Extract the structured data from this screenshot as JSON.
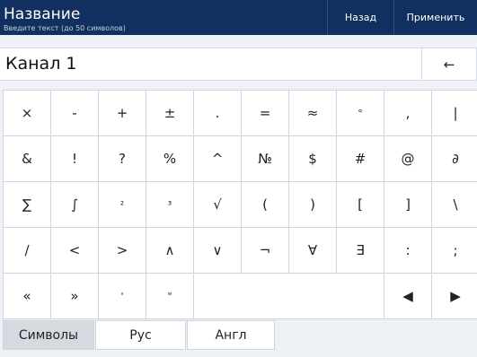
{
  "header": {
    "title": "Название",
    "subtitle": "Введите текст (до 50 символов)",
    "back_label": "Назад",
    "apply_label": "Применить"
  },
  "input": {
    "value": "Канал 1",
    "backspace_label": "←"
  },
  "keys": [
    [
      "×",
      "-",
      "+",
      "±",
      ".",
      "=",
      "≈",
      "°",
      ",",
      "|"
    ],
    [
      "&",
      "!",
      "?",
      "%",
      "^",
      "№",
      "$",
      "#",
      "@",
      "∂"
    ],
    [
      "∑",
      "∫",
      "²",
      "³",
      "√",
      "(",
      ")",
      "[",
      "]",
      "\\"
    ],
    [
      "/",
      "<",
      ">",
      "∧",
      "∨",
      "¬",
      "∀",
      "∃",
      ":",
      ";"
    ],
    [
      "«",
      "»",
      "'",
      "\"",
      " ",
      "◀",
      "▶"
    ]
  ],
  "tabs": {
    "symbols": "Символы",
    "rus": "Рус",
    "eng": "Англ"
  },
  "colors": {
    "header_bg": "#12305f",
    "page_bg": "#eef1f6",
    "key_bg": "#ffffff",
    "active_tab_bg": "#d5d9e0"
  }
}
